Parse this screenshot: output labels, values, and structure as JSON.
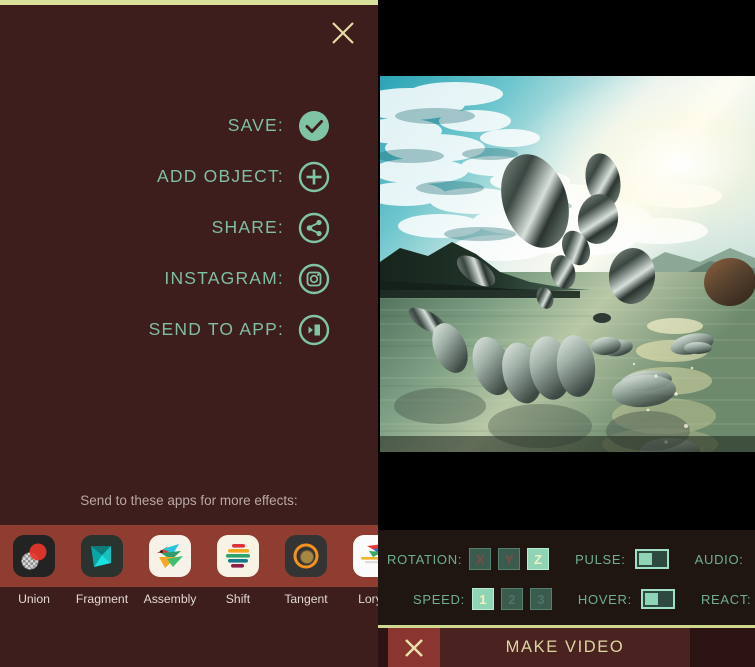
{
  "theme": {
    "panel_bg": "#3d1e1c",
    "accent_bar": "#d8e09a",
    "teal": "#7fbfa3",
    "app_strip_bg": "#8f3d31",
    "ctrl_bg": "#1f1612",
    "make_video_text": "#ddd6a2"
  },
  "left_panel": {
    "close_icon": "close-icon",
    "actions": [
      {
        "label": "SAVE:",
        "icon": "check-circle-filled-icon"
      },
      {
        "label": "ADD OBJECT:",
        "icon": "plus-circle-icon"
      },
      {
        "label": "SHARE:",
        "icon": "share-circle-icon"
      },
      {
        "label": "INSTAGRAM:",
        "icon": "instagram-circle-icon"
      },
      {
        "label": "SEND TO APP:",
        "icon": "send-to-app-circle-icon"
      }
    ],
    "send_hint": "Send to these apps for more effects:",
    "apps": [
      {
        "name": "Union",
        "icon": "union-app-icon"
      },
      {
        "name": "Fragment",
        "icon": "fragment-app-icon"
      },
      {
        "name": "Assembly",
        "icon": "assembly-app-icon"
      },
      {
        "name": "Shift",
        "icon": "shift-app-icon"
      },
      {
        "name": "Tangent",
        "icon": "tangent-app-icon"
      },
      {
        "name": "LoryS",
        "icon": "lorystripes-app-icon"
      }
    ]
  },
  "right_panel": {
    "preview": {
      "icon": "photo-preview",
      "description": "Floating stone discs over a lake at sunset"
    },
    "controls": {
      "rotation": {
        "label": "ROTATION:",
        "options": [
          {
            "value": "X",
            "selected": false
          },
          {
            "value": "Y",
            "selected": false
          },
          {
            "value": "Z",
            "selected": true
          }
        ]
      },
      "speed": {
        "label": "SPEED:",
        "options": [
          {
            "value": "1",
            "selected": true
          },
          {
            "value": "2",
            "selected": false
          },
          {
            "value": "3",
            "selected": false
          }
        ]
      },
      "pulse": {
        "label": "PULSE:",
        "on": false
      },
      "hover": {
        "label": "HOVER:",
        "on": false
      },
      "audio": {
        "label": "AUDIO:"
      },
      "react": {
        "label": "REACT:"
      }
    },
    "bottom_bar": {
      "close_icon": "close-icon",
      "make_video_label": "MAKE VIDEO"
    }
  }
}
